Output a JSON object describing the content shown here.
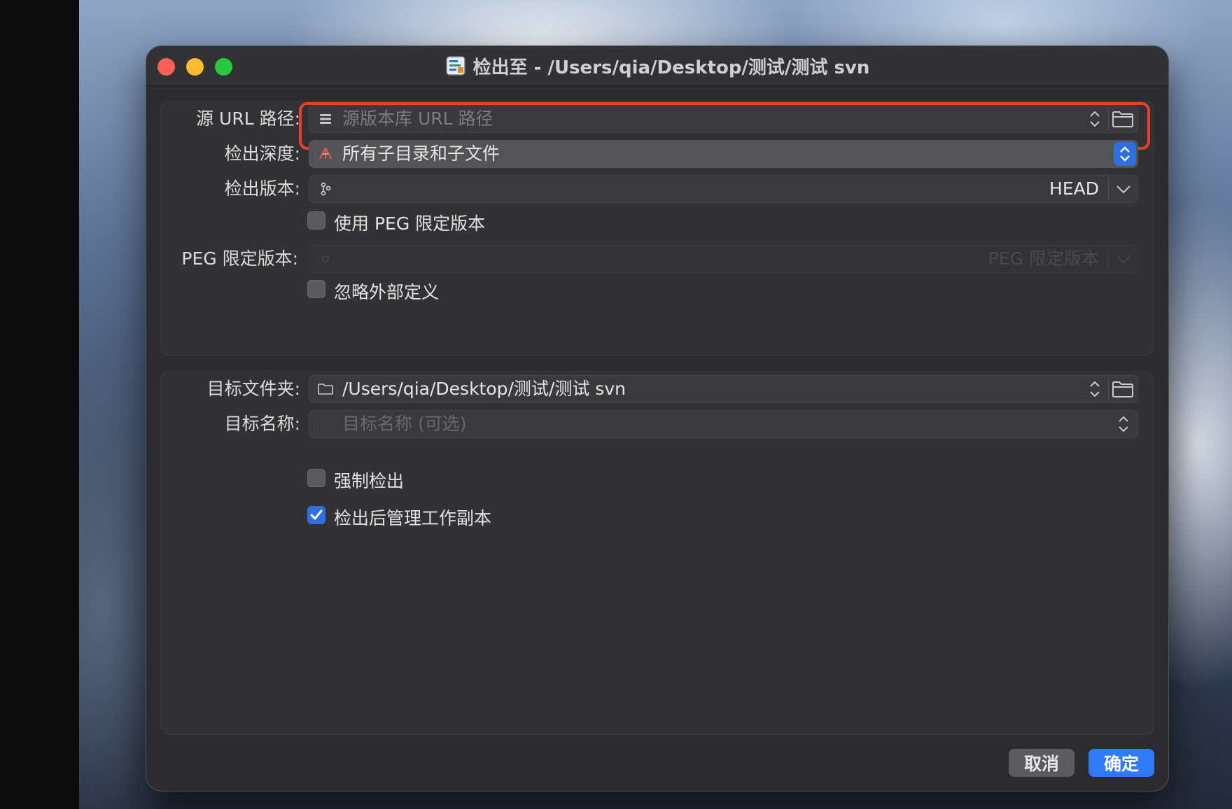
{
  "window": {
    "title": "检出至 - /Users/qia/Desktop/测试/测试 svn"
  },
  "source_group": {
    "source_url_label": "源 URL 路径:",
    "source_url_placeholder": "源版本库 URL 路径",
    "depth_label": "检出深度:",
    "depth_value": "所有子目录和子文件",
    "revision_label": "检出版本:",
    "revision_value": "HEAD",
    "use_peg_label": "使用 PEG 限定版本",
    "use_peg_checked": false,
    "peg_label": "PEG 限定版本:",
    "peg_placeholder": "PEG 限定版本",
    "ignore_externals_label": "忽略外部定义",
    "ignore_externals_checked": false
  },
  "target_group": {
    "target_folder_label": "目标文件夹:",
    "target_folder_value": "/Users/qia/Desktop/测试/测试 svn",
    "target_name_label": "目标名称:",
    "target_name_placeholder": "目标名称 (可选)",
    "force_checkout_label": "强制检出",
    "force_checkout_checked": false,
    "manage_copy_label": "检出后管理工作副本",
    "manage_copy_checked": true
  },
  "buttons": {
    "cancel": "取消",
    "ok": "确定"
  },
  "colors": {
    "accent": "#2f7bf5",
    "highlight": "#e8402d",
    "window_bg": "#2c2c2e"
  }
}
